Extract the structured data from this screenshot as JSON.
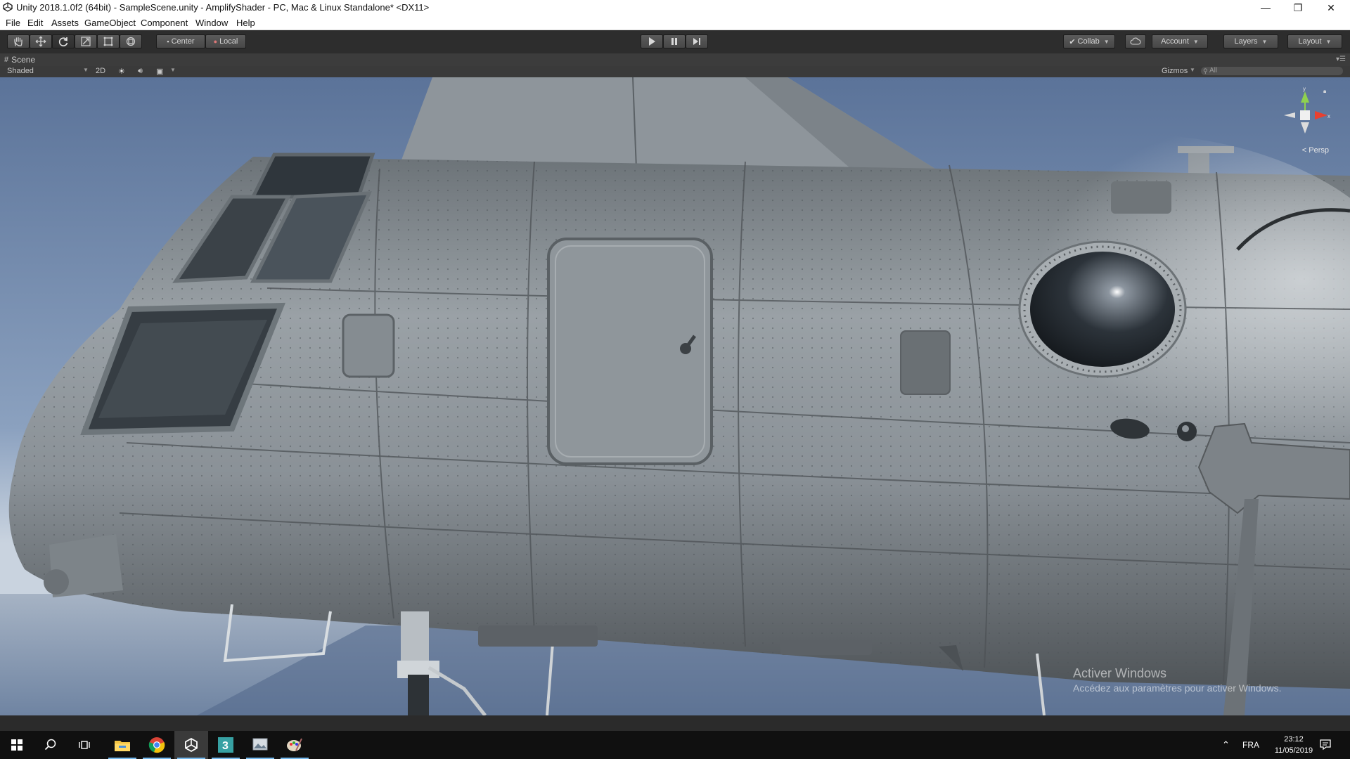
{
  "window": {
    "title": "Unity 2018.1.0f2 (64bit) - SampleScene.unity - AmplifyShader - PC, Mac & Linux Standalone* <DX11>",
    "controls": {
      "minimize": "—",
      "restore": "❐",
      "close": "✕"
    }
  },
  "menu": [
    "File",
    "Edit",
    "Assets",
    "GameObject",
    "Component",
    "Window",
    "Help"
  ],
  "toolbar": {
    "tools": [
      "hand-icon",
      "move-icon",
      "rotate-icon",
      "scale-icon",
      "rect-icon",
      "transform-icon"
    ],
    "active_tool": "rotate-icon",
    "pivot_mode": "Center",
    "pivot_rotation": "Local",
    "collab": "Collab",
    "account": "Account",
    "layers": "Layers",
    "layout": "Layout"
  },
  "scene": {
    "tab_label": "Scene",
    "shading_mode": "Shaded",
    "mode_2d": "2D",
    "gizmos": "Gizmos",
    "search_placeholder": "All",
    "projection": "Persp",
    "gizmo_axes": {
      "y": "y",
      "x": "x"
    }
  },
  "watermark": {
    "line1": "Activer Windows",
    "line2": "Accédez aux paramètres pour activer Windows."
  },
  "taskbar": {
    "apps": [
      "file-explorer-icon",
      "chrome-icon",
      "unity-icon",
      "3ds-max-icon",
      "image-viewer-icon",
      "paint-icon"
    ],
    "language": "FRA",
    "time": "23:12",
    "date": "11/05/2019"
  },
  "colors": {
    "toolbar_bg": "#2d2d2d",
    "sky_top": "#5b7399",
    "sky_horizon": "#c9d3df",
    "ground": "#7e8fa5",
    "hull": "#8e959b",
    "taskbar": "#101010"
  }
}
